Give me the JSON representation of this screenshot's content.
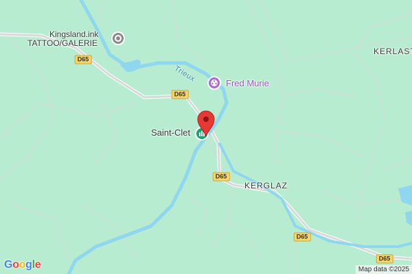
{
  "map": {
    "background": "#b8ecd0",
    "river_color": "#8fd7ee",
    "road_color": "#d9d9d9",
    "river_name": "Trieux",
    "road_labels": [
      "D65",
      "D65",
      "D65",
      "D65",
      "D65"
    ],
    "places": {
      "saint_clet": "Saint-Clet",
      "kerglaz": "KERGLAZ",
      "kerlast": "KERLAST"
    },
    "pois": {
      "kingsland_line1": "Kingsland.ink",
      "kingsland_line2": "TATTOO/GALERIE",
      "fred_murie": "Fred Murie",
      "fred_murie_color": "#a86ad3",
      "kingsland_color": "#8a8a8a",
      "saint_clet_icon_color": "#16a56b"
    },
    "marker_color": "#e53935",
    "attribution": "Map data ©2025",
    "logo_letters": [
      "G",
      "o",
      "o",
      "g",
      "l",
      "e"
    ],
    "logo_colors": [
      "#4285f4",
      "#ea4335",
      "#fbbc05",
      "#4285f4",
      "#34a853",
      "#ea4335"
    ]
  }
}
